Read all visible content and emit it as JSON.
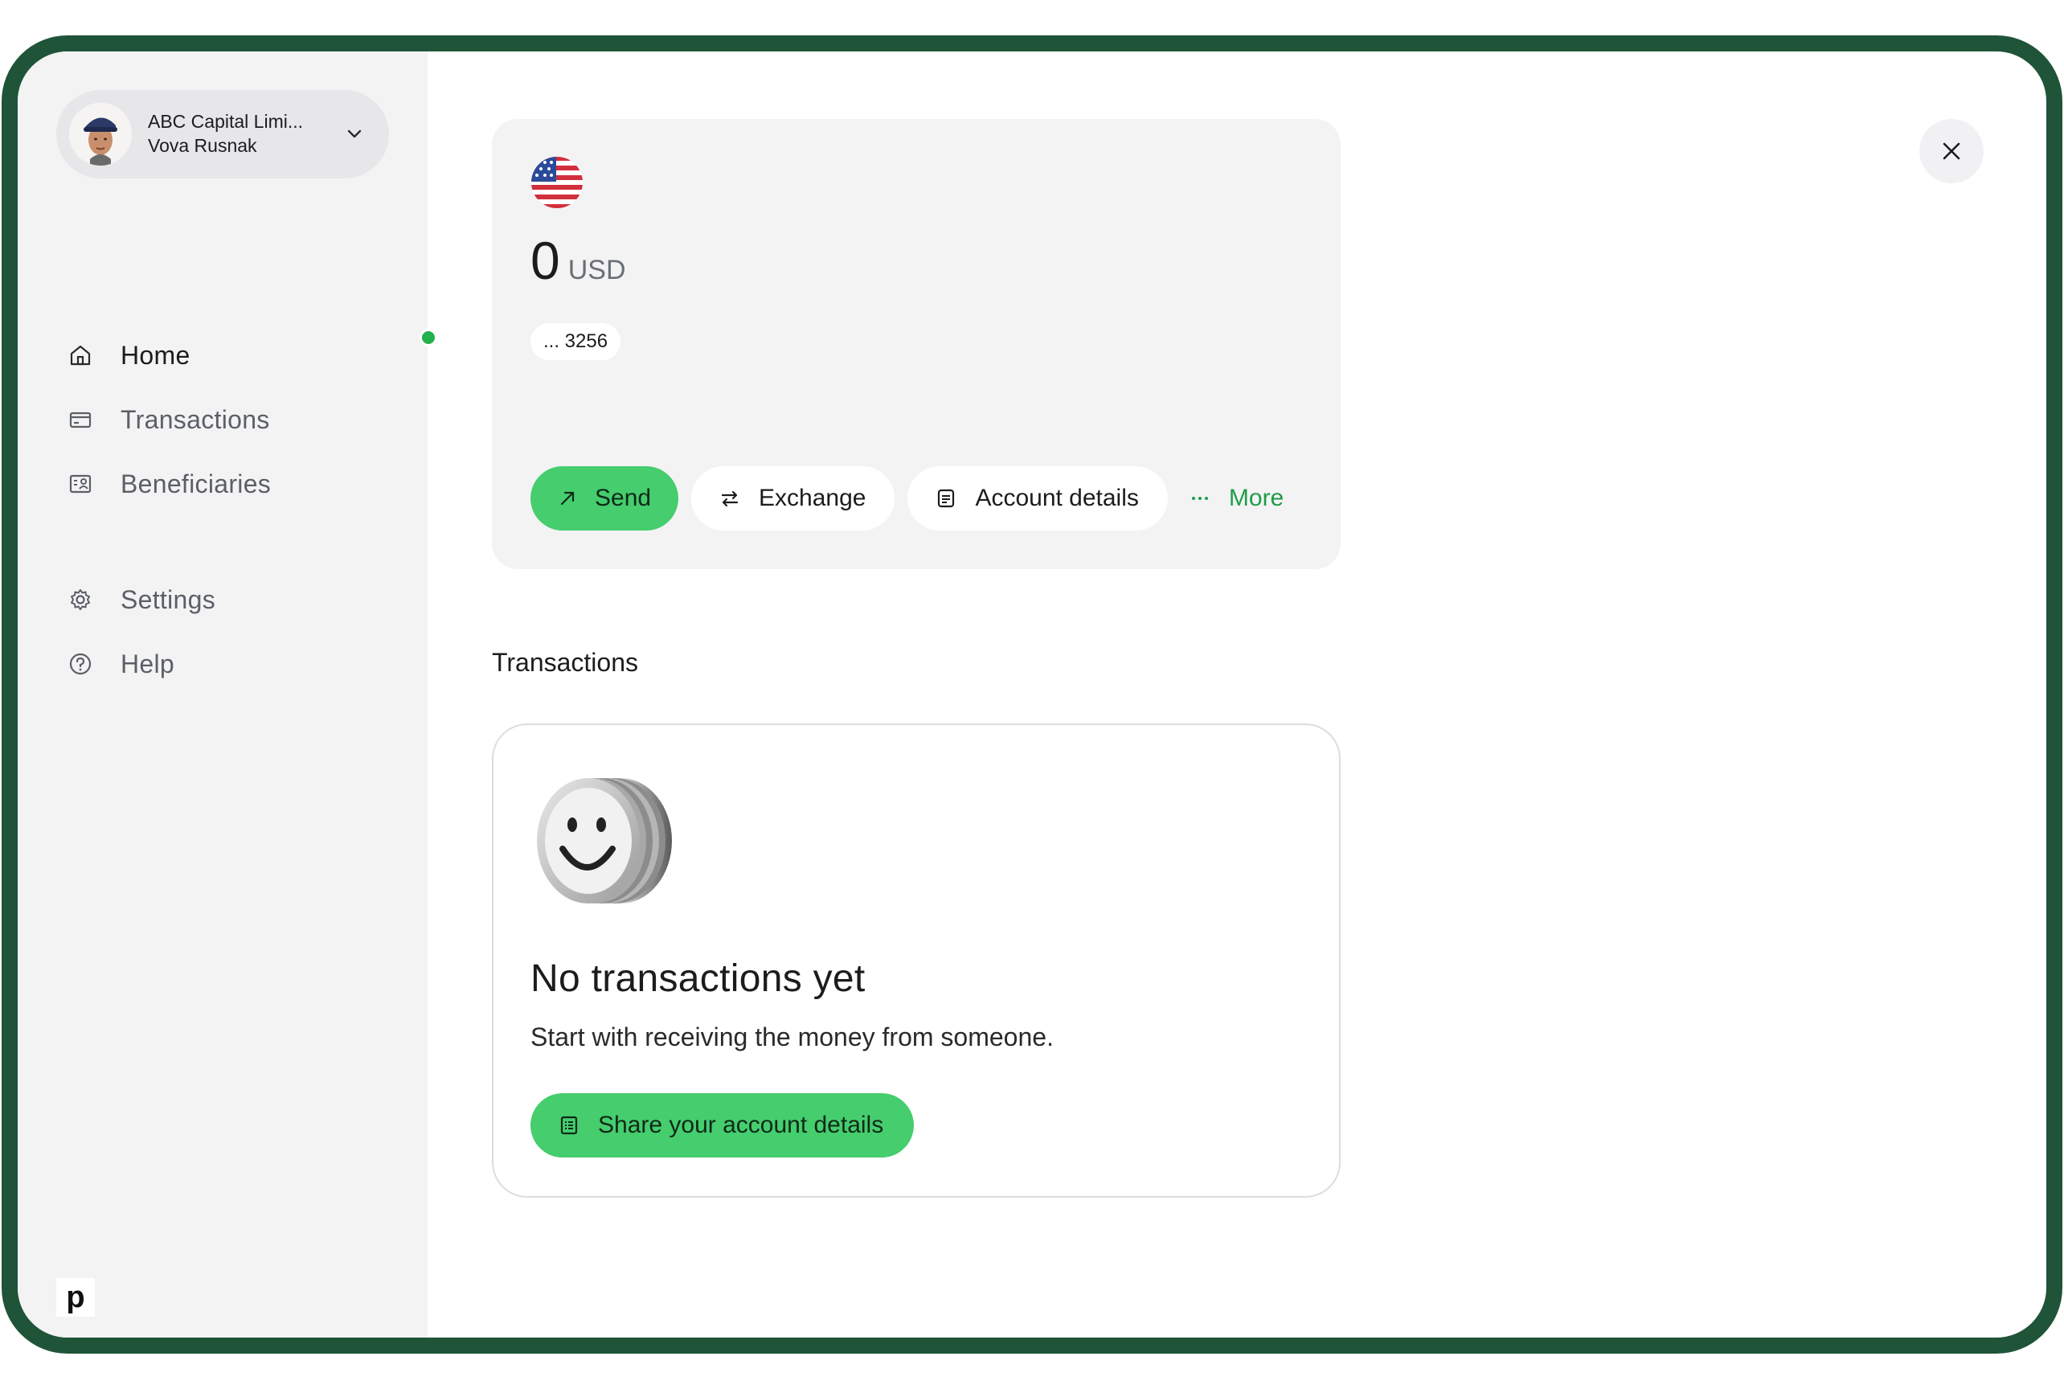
{
  "account": {
    "company": "ABC Capital Limi...",
    "user": "Vova Rusnak"
  },
  "sidebar": {
    "items": [
      {
        "label": "Home",
        "icon": "home-icon"
      },
      {
        "label": "Transactions",
        "icon": "card-icon"
      },
      {
        "label": "Beneficiaries",
        "icon": "contact-card-icon"
      },
      {
        "label": "Settings",
        "icon": "gear-icon"
      },
      {
        "label": "Help",
        "icon": "help-circle-icon"
      }
    ],
    "brand_logo": "p"
  },
  "balance": {
    "amount": "0",
    "currency": "USD",
    "account_suffix": "... 3256",
    "flag": "us-flag-icon"
  },
  "actions": {
    "send_label": "Send",
    "exchange_label": "Exchange",
    "account_details_label": "Account details",
    "more_label": "More"
  },
  "transactions": {
    "section_title": "Transactions",
    "empty_title": "No transactions yet",
    "empty_subtitle": "Start with receiving the money from someone.",
    "share_button_label": "Share your account details"
  },
  "colors": {
    "frame": "#1f5438",
    "accent_green": "#45cd6e",
    "more_green": "#1f9d46",
    "active_dot": "#22b14c",
    "sidebar_bg": "#f3f3f4"
  }
}
